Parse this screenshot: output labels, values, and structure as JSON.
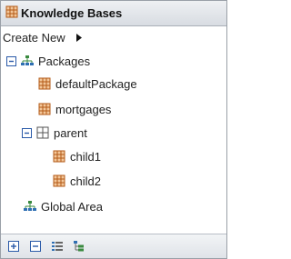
{
  "panel": {
    "title": "Knowledge Bases",
    "title_icon": "knowledge-base-icon"
  },
  "toolbar": {
    "create_new_label": "Create New"
  },
  "tree": {
    "packages_label": "Packages",
    "default_package_label": "defaultPackage",
    "mortgages_label": "mortgages",
    "parent_label": "parent",
    "child1_label": "child1",
    "child2_label": "child2",
    "global_area_label": "Global Area"
  },
  "bottom_toolbar": {
    "buttons": [
      "expand-all-icon",
      "collapse-all-icon",
      "flat-view-icon",
      "hierarchical-view-icon"
    ]
  },
  "colors": {
    "package_icon": "#d9782a",
    "tree_icon": "#2e7d32",
    "title_gradient_top": "#eef0f3",
    "title_gradient_bottom": "#d8dce2"
  }
}
